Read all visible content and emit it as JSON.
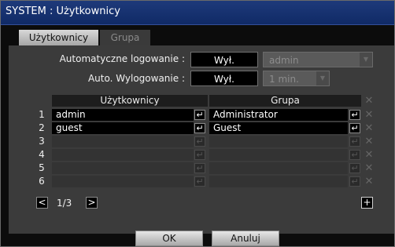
{
  "title": "SYSTEM : Użytkownicy",
  "tabs": [
    {
      "label": "Użytkownicy",
      "active": true
    },
    {
      "label": "Grupa",
      "active": false
    }
  ],
  "settings": {
    "auto_login": {
      "label": "Automatyczne logowanie :",
      "value": "Wył.",
      "user": "admin"
    },
    "auto_logout": {
      "label": "Auto. Wylogowanie :",
      "value": "Wył.",
      "time": "1 min."
    }
  },
  "table": {
    "headers": [
      "Użytkownicy",
      "Grupa"
    ],
    "rows": [
      {
        "num": "1",
        "user": "admin",
        "group": "Administrator"
      },
      {
        "num": "2",
        "user": "guest",
        "group": "Guest"
      },
      {
        "num": "3",
        "user": "",
        "group": ""
      },
      {
        "num": "4",
        "user": "",
        "group": ""
      },
      {
        "num": "5",
        "user": "",
        "group": ""
      },
      {
        "num": "6",
        "user": "",
        "group": ""
      }
    ]
  },
  "icons": {
    "return": "↵",
    "delete": "✕",
    "prev": "<",
    "next": ">",
    "add": "+",
    "dropdown": "▼"
  },
  "pagination": {
    "page": "1/3"
  },
  "buttons": {
    "ok": "OK",
    "cancel": "Anuluj"
  }
}
